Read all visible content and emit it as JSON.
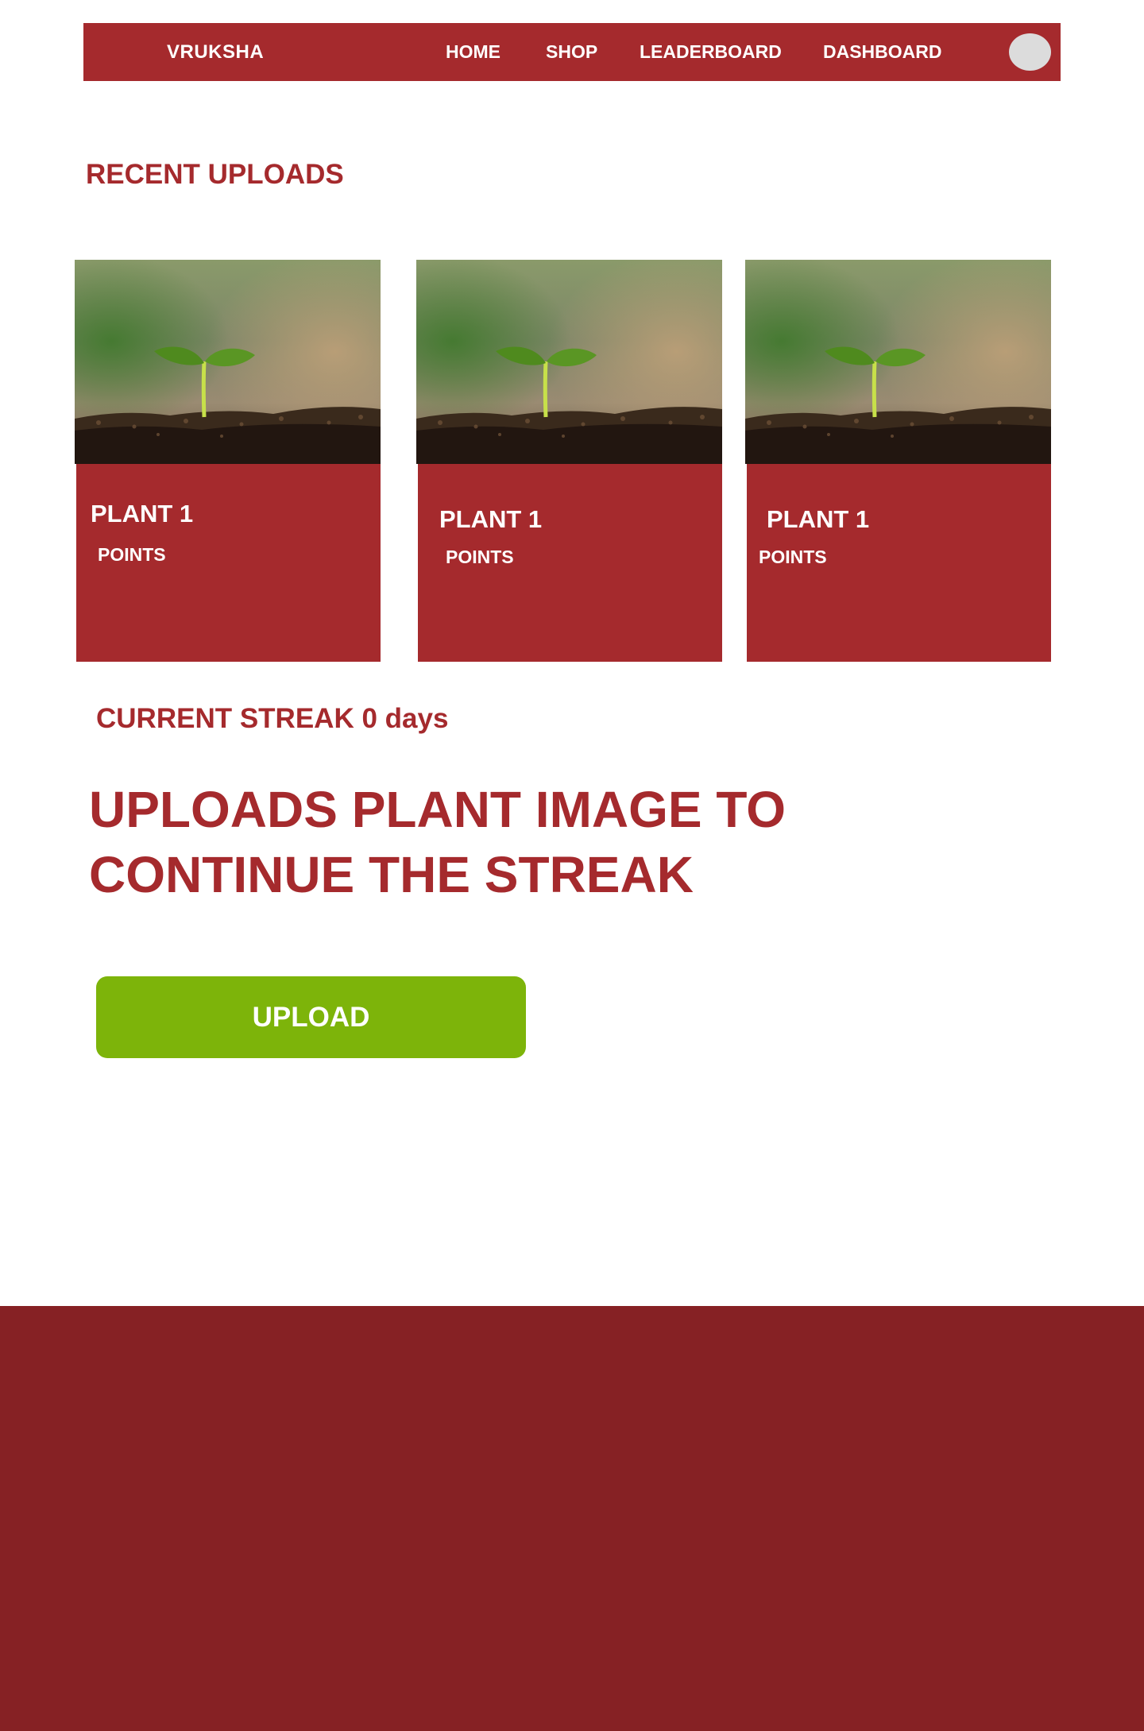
{
  "colors": {
    "brand_red": "#a52a2d",
    "footer_red": "#862124",
    "upload_green": "#7db40a",
    "avatar_gray": "#dcdcdc"
  },
  "navbar": {
    "brand": "VRUKSHA",
    "links": [
      "HOME",
      "SHOP",
      "LEADERBOARD",
      "DASHBOARD"
    ],
    "avatar_icon": "user-avatar"
  },
  "recent_uploads": {
    "title": "RECENT UPLOADS",
    "cards": [
      {
        "title": "PLANT 1",
        "points_label": "POINTS",
        "image": "seedling-photo"
      },
      {
        "title": "PLANT 1",
        "points_label": "POINTS",
        "image": "seedling-photo"
      },
      {
        "title": "PLANT 1",
        "points_label": "POINTS",
        "image": "seedling-photo"
      }
    ]
  },
  "streak": {
    "text": "CURRENT STREAK 0 days"
  },
  "headline": "UPLOADS  PLANT IMAGE TO\nCONTINUE THE STREAK",
  "upload_button": "UPLOAD"
}
